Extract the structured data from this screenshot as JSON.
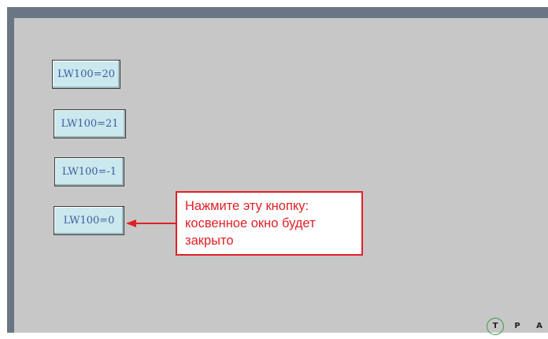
{
  "buttons": [
    {
      "label": "LW100=20"
    },
    {
      "label": "LW100=21"
    },
    {
      "label": "LW100=-1"
    },
    {
      "label": "LW100=0"
    }
  ],
  "callout": {
    "lines": [
      "Нажмите эту кнопку:",
      "косвенное окно будет",
      "закрыто"
    ],
    "color": "#e02026"
  },
  "nav": {
    "t": "T",
    "p": "P",
    "a": "A"
  },
  "colors": {
    "screen_bg": "#c7c7c7",
    "frame_bar": "#6a7683",
    "button_bg": "#cbe8ee",
    "button_text": "#3a5ea0"
  }
}
